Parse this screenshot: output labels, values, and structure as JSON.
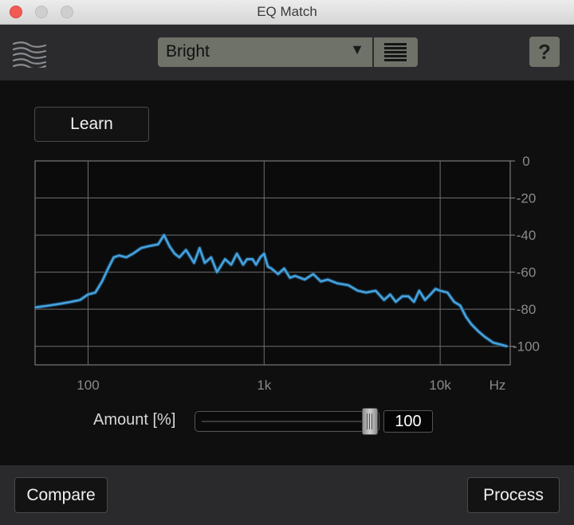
{
  "window": {
    "title": "EQ Match"
  },
  "toolbar": {
    "logo_icon": "waves-logo-icon",
    "preset": {
      "selected": "Bright",
      "arrow": "▼"
    },
    "preset_menu_icon": "list-menu-icon",
    "help_label": "?"
  },
  "main": {
    "learn_label": "Learn",
    "amount": {
      "label": "Amount [%]",
      "value": "100",
      "level_percent": 100
    }
  },
  "footer": {
    "compare_label": "Compare",
    "process_label": "Process"
  },
  "colors": {
    "curve": "#45a3df",
    "accent_gray": "#6e7269",
    "panel": "#0f0f10"
  },
  "chart_data": {
    "type": "line",
    "x_scale": "log",
    "xlim": [
      50,
      25000
    ],
    "ylim": [
      -110,
      0
    ],
    "grid": true,
    "xlabel": "Hz",
    "x_ticks": [
      {
        "value": 100,
        "label": "100"
      },
      {
        "value": 1000,
        "label": "1k"
      },
      {
        "value": 10000,
        "label": "10k"
      }
    ],
    "y_ticks": [
      {
        "value": 0,
        "label": "0"
      },
      {
        "value": -20,
        "label": "-20"
      },
      {
        "value": -40,
        "label": "-40"
      },
      {
        "value": -60,
        "label": "-60"
      },
      {
        "value": -80,
        "label": "-80"
      },
      {
        "value": -100,
        "label": "-100"
      }
    ],
    "series": [
      {
        "x": [
          50,
          60,
          70,
          80,
          90,
          100,
          110,
          120,
          130,
          140,
          150,
          165,
          180,
          200,
          220,
          250,
          270,
          290,
          310,
          330,
          360,
          400,
          430,
          460,
          500,
          540,
          600,
          650,
          700,
          760,
          800,
          860,
          900,
          950,
          1000,
          1050,
          1100,
          1200,
          1300,
          1400,
          1500,
          1700,
          1900,
          2100,
          2300,
          2600,
          3000,
          3400,
          3800,
          4300,
          4800,
          5200,
          5600,
          6100,
          6600,
          7100,
          7600,
          8200,
          8800,
          9400,
          10000,
          11000,
          12000,
          13000,
          14000,
          15000,
          16500,
          18000,
          20000,
          22000,
          24000
        ],
        "y": [
          -79,
          -78,
          -77,
          -76,
          -75,
          -72,
          -71,
          -65,
          -58,
          -52,
          -51,
          -52,
          -50,
          -47,
          -46,
          -45,
          -40,
          -46,
          -50,
          -52,
          -48,
          -55,
          -47,
          -55,
          -52,
          -60,
          -53,
          -56,
          -50,
          -56,
          -53,
          -53,
          -56,
          -52,
          -50,
          -57,
          -58,
          -61,
          -58,
          -63,
          -62,
          -64,
          -61,
          -65,
          -64,
          -66,
          -67,
          -70,
          -71,
          -70,
          -75,
          -72,
          -76,
          -73,
          -73,
          -76,
          -70,
          -75,
          -72,
          -69,
          -70,
          -71,
          -76,
          -78,
          -84,
          -88,
          -92,
          -95,
          -98,
          -99,
          -100
        ]
      }
    ]
  }
}
